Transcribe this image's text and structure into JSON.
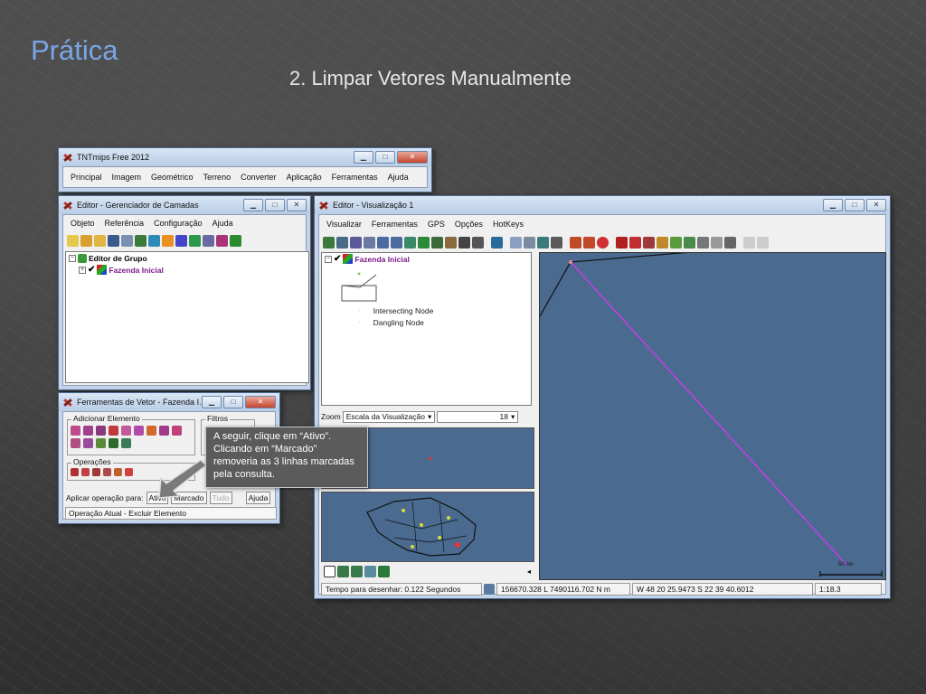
{
  "slide": {
    "title": "Prática",
    "subtitle": "2. Limpar Vetores Manualmente"
  },
  "tnt_window": {
    "title": "TNTmips Free 2012",
    "menu": [
      "Principal",
      "Imagem",
      "Geométrico",
      "Terreno",
      "Converter",
      "Aplicação",
      "Ferramentas",
      "Ajuda"
    ]
  },
  "layer_manager": {
    "title": "Editor - Gerenciador de Camadas",
    "menu": [
      "Objeto",
      "Referência",
      "Configuração",
      "Ajuda"
    ],
    "tree": {
      "group": "Editor de Grupo",
      "layer": "Fazenda Inicial"
    }
  },
  "vector_tools": {
    "title": "Ferramentas de Vetor - Fazenda I...",
    "add_element_label": "Adicionar Elemento",
    "filters_label": "Filtros",
    "operations_label": "Operações",
    "apply_label": "Aplicar operação para:",
    "buttons": {
      "active": "Ativo",
      "marked": "Marcado",
      "all": "Tudo",
      "help": "Ajuda"
    },
    "current_operation": "Operação Atual - Excluir Elemento"
  },
  "callout": {
    "text": "A seguir, clique em “Ativo”. Clicando em “Marcado” removeria as 3 linhas marcadas pela consulta."
  },
  "view_window": {
    "title": "Editor - Visualização 1",
    "menu": [
      "Visualizar",
      "Ferramentas",
      "GPS",
      "Opções",
      "HotKeys"
    ],
    "legend": {
      "layer": "Fazenda Inicial",
      "intersecting": "Intersecting Node",
      "dangling": "Dangling Node"
    },
    "zoom": {
      "label": "Zoom",
      "select_value": "Escala da Visualização",
      "value": "18"
    },
    "scale_bar": "50 cm",
    "status": {
      "draw_time": "Tempo para desenhar: 0.122 Segundos",
      "coords_m": "156670.328 L  7490116.702 N m",
      "coords_geo": "W 48 20 25.9473  S 22 39 40.6012",
      "scale": "1:18.3"
    },
    "colors": {
      "map_bg": "#4a6a90",
      "selected_line": "#c040e0"
    }
  }
}
